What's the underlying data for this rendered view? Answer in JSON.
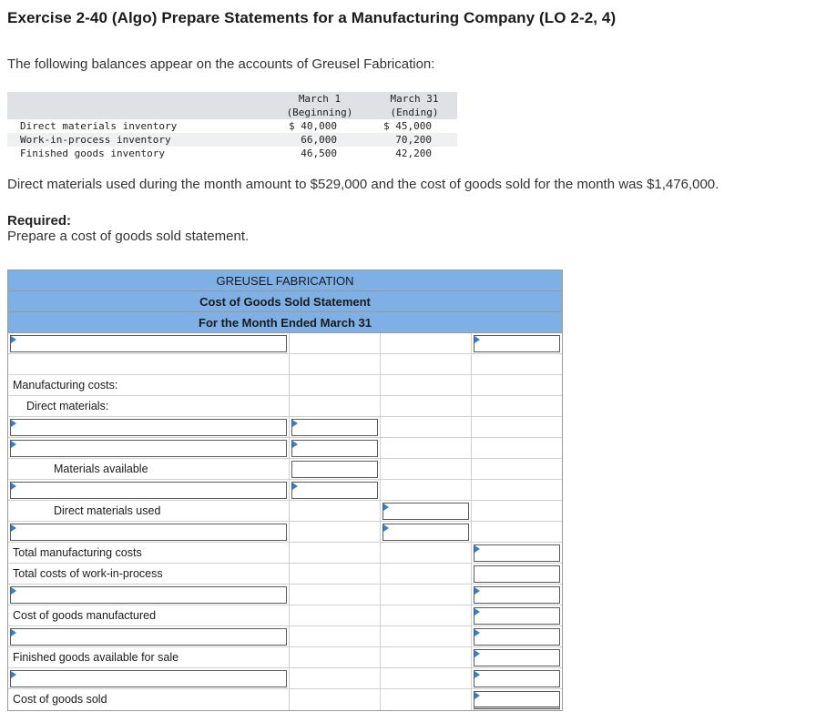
{
  "exercise_title": "Exercise 2-40 (Algo) Prepare Statements for a Manufacturing Company (LO 2-2, 4)",
  "intro": "The following balances appear on the accounts of Greusel Fabrication:",
  "balances": {
    "col1_head1": "March 1",
    "col1_head2": "(Beginning)",
    "col2_head1": "March 31",
    "col2_head2": "(Ending)",
    "rows": [
      {
        "label": "Direct materials inventory",
        "beg": "$ 40,000",
        "end": "$ 45,000"
      },
      {
        "label": "Work-in-process inventory",
        "beg": "66,000",
        "end": "70,200"
      },
      {
        "label": "Finished goods inventory",
        "beg": "46,500",
        "end": "42,200"
      }
    ]
  },
  "statement": "Direct materials used during the month amount to $529,000 and the cost of goods sold for the month was $1,476,000.",
  "required_label": "Required:",
  "required_text": "Prepare a cost of goods sold statement.",
  "worksheet": {
    "company": "GREUSEL FABRICATION",
    "statement_name": "Cost of Goods Sold Statement",
    "period": "For the Month Ended March 31",
    "labels": {
      "manufacturing_costs": "Manufacturing costs:",
      "direct_materials": "Direct materials:",
      "materials_available": "Materials available",
      "direct_materials_used": "Direct materials used",
      "total_manufacturing_costs": "Total manufacturing costs",
      "total_costs_wip": "Total costs of work-in-process",
      "cost_goods_manufactured": "Cost of goods manufactured",
      "finished_goods_available": "Finished goods available for sale",
      "cost_goods_sold": "Cost of goods sold"
    }
  },
  "colors": {
    "header_blue": "#7eb0e6",
    "input_flag": "#2f7fd6"
  }
}
